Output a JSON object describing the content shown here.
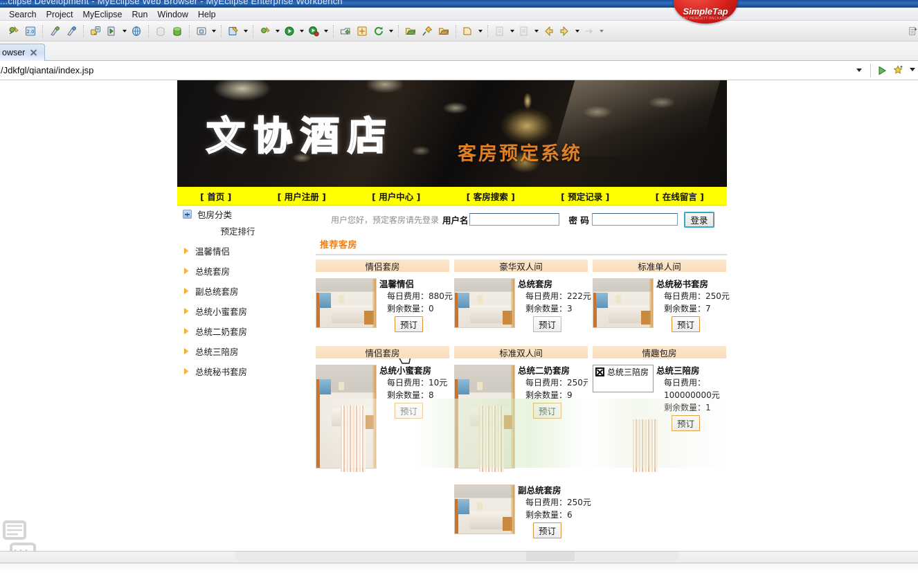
{
  "ide": {
    "window_title": "...clipse Development - MyEclipse Web Browser - MyEclipse Enterprise Workbench",
    "menus": [
      "Search",
      "Project",
      "MyEclipse",
      "Run",
      "Window",
      "Help"
    ],
    "toolbar_icons": [
      "debug-icon",
      "java-2.0-icon",
      "new-wizard-icon",
      "new-wizard-2-icon",
      "deploy-icon",
      "run-server-icon",
      "web-browser-icon",
      "database-explorer-icon",
      "db-connect-icon",
      "snapshot-icon",
      "edit-config-icon",
      "debug-as-icon",
      "run-as-icon",
      "run-last-icon",
      "export-icon",
      "add-bookmark-icon",
      "refresh-icon",
      "open-folder-icon",
      "pin-icon",
      "open-type-icon",
      "new-folder-icon",
      "next-annotation-icon",
      "previous-annotation-icon",
      "back-icon",
      "forward-icon",
      "next-edit-icon"
    ],
    "tab": {
      "label": "owser",
      "close_icon": "close-icon"
    },
    "url": "/Jdkfgl/qiantai/index.jsp",
    "go_button": "go-icon",
    "favorites_button": "favorites-star-icon",
    "badge": {
      "title": "SimpleTap",
      "subtitle": "BY HEWLETT-PACKARD"
    }
  },
  "site": {
    "banner": {
      "title": "文协酒店",
      "subtitle": "客房预定系统"
    },
    "nav": [
      "[ 首页 ]",
      "[ 用户注册 ]",
      "[ 用户中心 ]",
      "[ 客房搜索 ]",
      "[ 预定记录 ]",
      "[ 在线留言 ]"
    ],
    "login": {
      "hint": "用户您好，预定客房请先登录",
      "username_label": "用户名",
      "username_value": "",
      "password_label": "密 码",
      "password_value": "",
      "submit_label": "登录"
    },
    "sidebar": {
      "category_title": "包房分类",
      "category_icon": "expand-plus-icon",
      "ranking_title": "预定排行",
      "links": [
        "温馨情侣",
        "总统套房",
        "副总统套房",
        "总统小蜜套房",
        "总统二奶套房",
        "总统三陪房",
        "总统秘书套房"
      ]
    },
    "main": {
      "section_title": "推荐客房",
      "price_label": "每日费用：",
      "stock_label": "剩余数量：",
      "book_label": "预订",
      "cards": [
        {
          "category": "情侣套房",
          "name": "温馨情侣",
          "price": "880元",
          "stock": "0",
          "image": "room-photo",
          "hovered": true
        },
        {
          "category": "豪华双人间",
          "name": "总统套房",
          "price": "222元",
          "stock": "3",
          "image": "room-photo",
          "hovered": false
        },
        {
          "category": "标准单人间",
          "name": "总统秘书套房",
          "price": "250元",
          "stock": "7",
          "image": "room-photo",
          "hovered": false
        },
        {
          "category": "情侣套房",
          "name": "总统小蜜套房",
          "price": "10元",
          "stock": "8",
          "image": "room-photo-loading",
          "hovered": false
        },
        {
          "category": "标准双人间",
          "name": "总统二奶套房",
          "price": "250元",
          "stock": "9",
          "image": "room-photo-loading",
          "hovered": false
        },
        {
          "category": "情趣包房",
          "name": "总统三陪房",
          "price": "100000000元",
          "stock": "1",
          "image": "broken-image",
          "image_alt": "总统三陪房",
          "hovered": false
        },
        {
          "category": "",
          "name": "副总统套房",
          "price": "250元",
          "stock": "6",
          "image": "room-photo",
          "hovered": false
        }
      ]
    }
  },
  "colors": {
    "nav_background": "#ffff00",
    "section_title": "#f0801a",
    "card_header": "#f8ddb9",
    "book_button_border": "#e0922f",
    "banner_subtitle": "#f08a2a"
  }
}
